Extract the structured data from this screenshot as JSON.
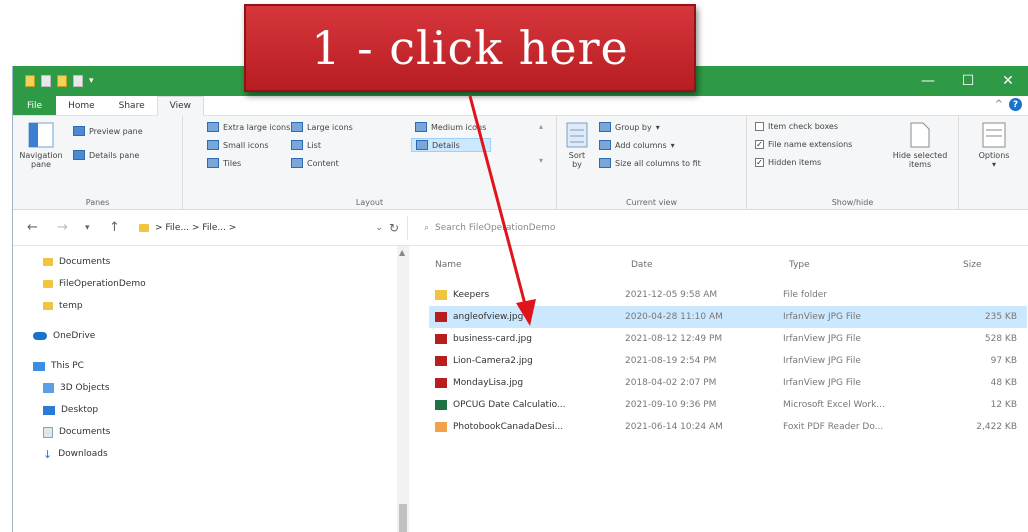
{
  "callout": {
    "text": "1 - click here",
    "color": "#c62a2f"
  },
  "accent": "#2f9a46",
  "ribbon_tabs": [
    "File",
    "Home",
    "Share",
    "View"
  ],
  "ribbon": {
    "panes": {
      "navigation_pane": "Navigation pane",
      "preview_pane": "Preview pane",
      "details_pane": "Details pane",
      "label": "Panes"
    },
    "layout": {
      "extra_large_icons": "Extra large icons",
      "large_icons": "Large icons",
      "medium_icons": "Medium icons",
      "small_icons": "Small icons",
      "list": "List",
      "details": "Details",
      "tiles": "Tiles",
      "content": "Content",
      "label": "Layout"
    },
    "current_view": {
      "sort_by": "Sort by",
      "group_by": "Group by",
      "add_columns": "Add columns",
      "size_all_columns": "Size all columns to fit",
      "label": "Current view"
    },
    "show_hide": {
      "item_check_boxes": "Item check boxes",
      "file_name_extensions": "File name extensions",
      "hidden_items": "Hidden items",
      "hide_selected_items": "Hide selected items",
      "label": "Show/hide"
    },
    "options": "Options"
  },
  "address": {
    "path": "> File... > File... >",
    "search_placeholder": "Search FileOperationDemo"
  },
  "nav_items": [
    "Documents",
    "FileOperationDemo",
    "temp",
    "OneDrive",
    "This PC",
    "3D Objects",
    "Desktop",
    "Documents",
    "Downloads"
  ],
  "columns": {
    "name": "Name",
    "date": "Date",
    "type": "Type",
    "size": "Size"
  },
  "files": [
    {
      "name": "Keepers",
      "date": "2021-12-05 9:58 AM",
      "type": "File folder",
      "size": "",
      "icon": "folder-icon"
    },
    {
      "name": "angleofview.jpg",
      "date": "2020-04-28 11:10 AM",
      "type": "IrfanView JPG File",
      "size": "235 KB",
      "icon": "irfanview-icon",
      "selected": true
    },
    {
      "name": "business-card.jpg",
      "date": "2021-08-12 12:49 PM",
      "type": "IrfanView JPG File",
      "size": "528 KB",
      "icon": "irfanview-icon"
    },
    {
      "name": "Lion-Camera2.jpg",
      "date": "2021-08-19 2:54 PM",
      "type": "IrfanView JPG File",
      "size": "97 KB",
      "icon": "irfanview-icon"
    },
    {
      "name": "MondayLisa.jpg",
      "date": "2018-04-02 2:07 PM",
      "type": "IrfanView JPG File",
      "size": "48 KB",
      "icon": "irfanview-icon"
    },
    {
      "name": "OPCUG Date Calculatio...",
      "date": "2021-09-10 9:36 PM",
      "type": "Microsoft Excel Work...",
      "size": "12 KB",
      "icon": "excel-icon"
    },
    {
      "name": "PhotobookCanadaDesi...",
      "date": "2021-06-14 10:24 AM",
      "type": "Foxit PDF Reader Do...",
      "size": "2,422 KB",
      "icon": "pdf-icon"
    }
  ]
}
